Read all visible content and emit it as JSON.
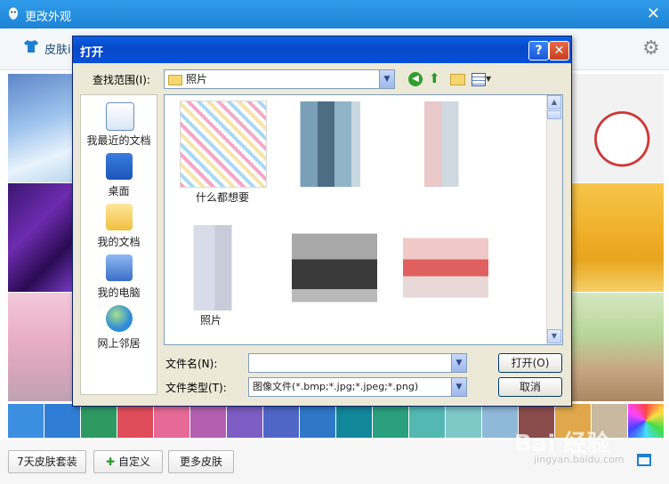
{
  "outer": {
    "title": "更改外观",
    "close_glyph": "✕",
    "toolbar_tab": "皮肤i",
    "gear_glyph": "⚙",
    "bottom_buttons": {
      "suit": "7天皮肤套装",
      "custom": "自定义",
      "more": "更多皮肤"
    },
    "plus_glyph": "✚"
  },
  "dialog": {
    "title": "打开",
    "help_glyph": "?",
    "close_glyph": "✕",
    "lookin_label": "查找范围(I):",
    "lookin_value": "照片",
    "places": [
      {
        "label": "我最近的文档"
      },
      {
        "label": "桌面"
      },
      {
        "label": "我的文档"
      },
      {
        "label": "我的电脑"
      },
      {
        "label": "网上邻居"
      }
    ],
    "files": [
      {
        "name": "什么都想要"
      },
      {
        "name": ""
      },
      {
        "name": ""
      },
      {
        "name": "照片"
      },
      {
        "name": ""
      },
      {
        "name": ""
      }
    ],
    "filename_label": "文件名(N):",
    "filename_value": "",
    "filetype_label": "文件类型(T):",
    "filetype_value": "图像文件(*.bmp;*.jpg;*.jpeg;*.png)",
    "open_button": "打开(O)",
    "cancel_button": "取消"
  },
  "watermark": {
    "text": "Bai 经验",
    "sub": "jingyan.baidu.com"
  }
}
